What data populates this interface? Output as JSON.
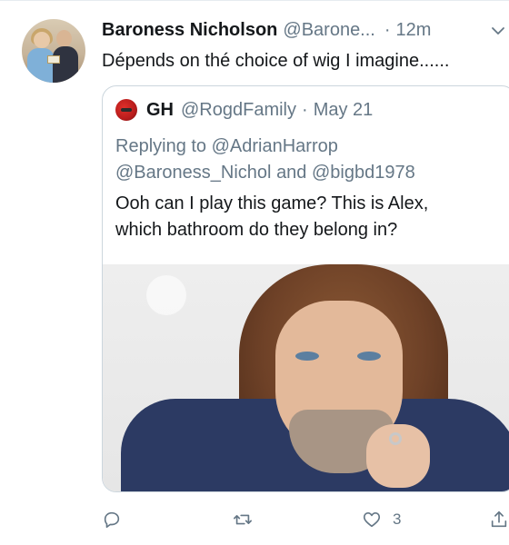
{
  "tweet": {
    "author_name": "Baroness Nicholson",
    "author_handle": "@Barone...",
    "separator": "·",
    "time": "12m",
    "text": "Dépends on thé choice of wig I imagine......",
    "actions": {
      "reply_icon": "reply-icon",
      "retweet_icon": "retweet-icon",
      "like_icon": "heart-icon",
      "like_count": "3",
      "share_icon": "share-icon"
    }
  },
  "quoted": {
    "author_name": "GH",
    "author_handle": "@RogdFamily",
    "separator": "·",
    "date": "May 21",
    "replying_prefix": "Replying to",
    "replying_line1_mention": "@AdrianHarrop",
    "replying_line2_mention1": "@Baroness_Nichol",
    "replying_and": "and",
    "replying_line2_mention2": "@bigbd1978",
    "text_line1": "Ooh can I play this game? This is Alex,",
    "text_line2": "which bathroom do they belong in?"
  },
  "colors": {
    "text_primary": "#14171a",
    "text_secondary": "#657786",
    "border": "#ccd6dd",
    "accent": "#1da1f2"
  }
}
